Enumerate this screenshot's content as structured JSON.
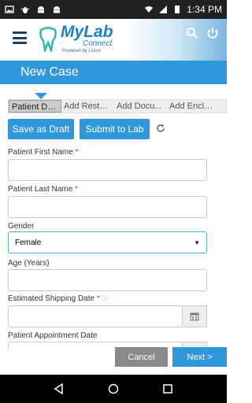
{
  "status_bar": {
    "time": "1:34 PM",
    "left_icons": [
      "image-icon",
      "debug-icon",
      "android-icon",
      "android-icon"
    ],
    "right_icons": [
      "wifi-icon",
      "signal-icon",
      "battery-icon"
    ]
  },
  "header": {
    "app_name": "MyLab",
    "app_sub": "Connect",
    "tagline": "Powered by Lision",
    "brand_color": "#1a83c6",
    "actions": [
      "search-icon",
      "power-icon"
    ]
  },
  "case_bar": {
    "title": "New Case",
    "color": "#2f98dd"
  },
  "steps": [
    {
      "label": "Patient Det...",
      "active": true
    },
    {
      "label": "Add Restor...",
      "active": false
    },
    {
      "label": "Add Docu...",
      "active": false
    },
    {
      "label": "Add Enclos...",
      "active": false
    }
  ],
  "toolbar": {
    "draft_label": "Save as Draft",
    "submit_label": "Submit to Lab",
    "refresh_icon": "refresh-icon"
  },
  "form": {
    "first_name_label": "Patient First Name",
    "first_name_required": "*",
    "first_name_value": "",
    "last_name_label": "Patient Last Name",
    "last_name_required": "*",
    "last_name_value": "",
    "gender_label": "Gender",
    "gender_value": "Female",
    "age_label": "Age (Years)",
    "age_value": "",
    "ship_date_label": "Estimated Shipping Date",
    "ship_date_required": "*",
    "ship_date_value": "",
    "appt_date_label": "Patient Appointment Date",
    "appt_date_value": ""
  },
  "footer": {
    "cancel_label": "Cancel",
    "next_label": "Next >"
  },
  "nav_bar": [
    "back-icon",
    "home-icon",
    "recents-icon"
  ]
}
